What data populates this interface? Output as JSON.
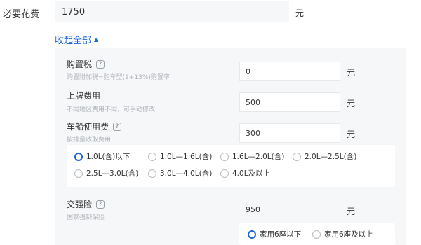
{
  "required_cost": {
    "label": "必要花费",
    "value": "1750",
    "unit": "元"
  },
  "collapse_toggle": {
    "label": "收起全部",
    "arrow": "▲"
  },
  "purchase_tax": {
    "title": "购置税",
    "help": "?",
    "subtitle": "购置附加税=购车型(1+13%)购置率",
    "value": "0",
    "unit": "元"
  },
  "registration_fee": {
    "title": "上牌费用",
    "subtitle": "不同地区费用不同，可手动修改",
    "value": "500",
    "unit": "元"
  },
  "vehicle_tax": {
    "title": "车船使用费",
    "help": "?",
    "subtitle": "按排量收取费用",
    "value": "300",
    "unit": "元",
    "options": [
      {
        "label": "1.0L(含)以下",
        "selected": true
      },
      {
        "label": "1.0L—1.6L(含)",
        "selected": false
      },
      {
        "label": "1.6L—2.0L(含)",
        "selected": false
      },
      {
        "label": "2.0L—2.5L(含)",
        "selected": false
      },
      {
        "label": "2.5L—3.0L(含)",
        "selected": false
      },
      {
        "label": "3.0L—4.0L(含)",
        "selected": false
      },
      {
        "label": "4.0L及以上",
        "selected": false
      }
    ]
  },
  "compulsory_insurance": {
    "title": "交强险",
    "help": "?",
    "subtitle": "国家强制保险",
    "value": "950",
    "unit": "元",
    "options": [
      {
        "label": "家用6座以下",
        "selected": true
      },
      {
        "label": "家用6座及以上",
        "selected": false
      }
    ]
  },
  "colors": {
    "accent": "#1e68d3",
    "panel_bg": "#f6f7f9",
    "muted_text": "#b0b4b9"
  }
}
